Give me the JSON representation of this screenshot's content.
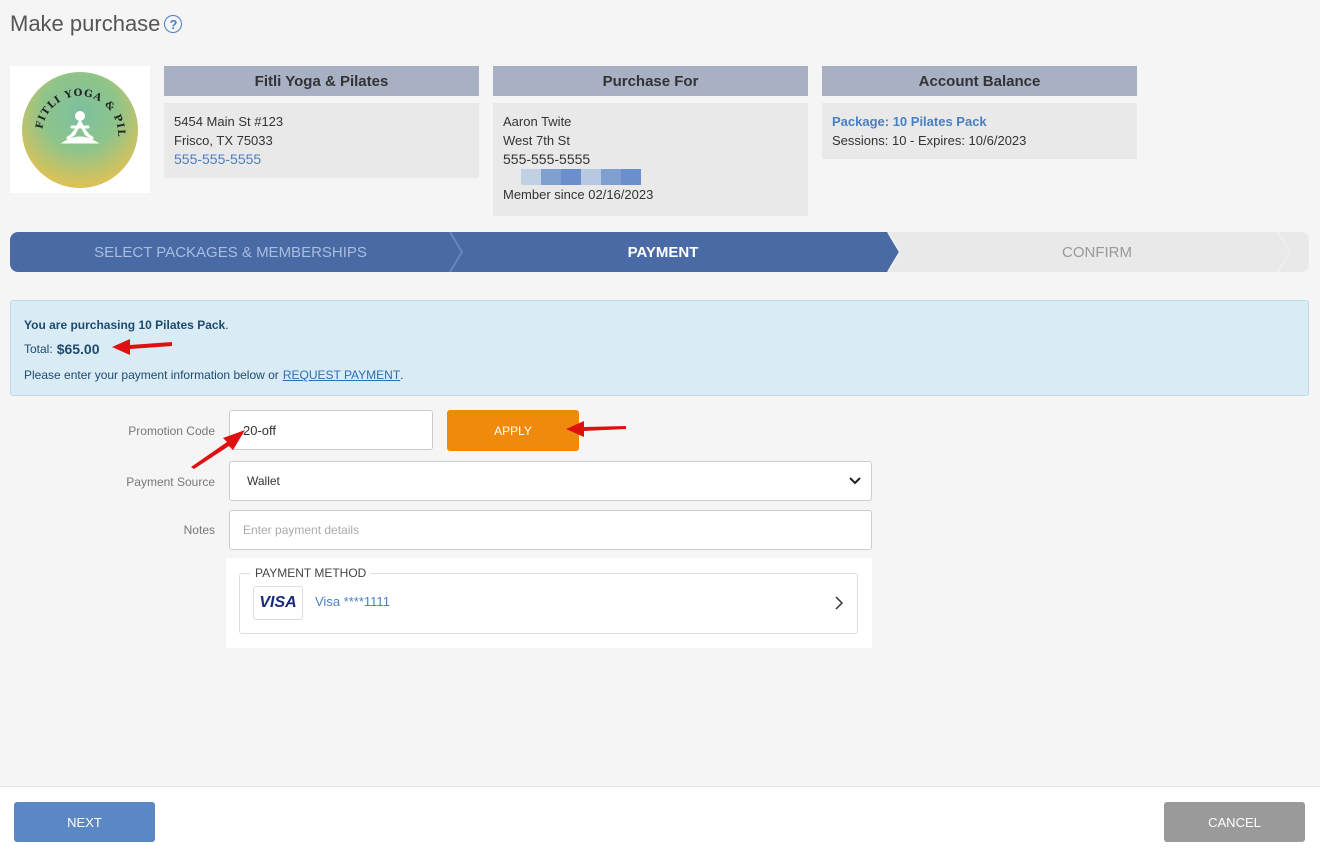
{
  "page": {
    "title": "Make purchase"
  },
  "studio": {
    "header": "Fitli Yoga & Pilates",
    "address1": "5454 Main St #123",
    "address2": "Frisco, TX 75033",
    "phone": "555-555-5555",
    "logo_text": "FITLI YOGA & PILATES"
  },
  "purchase_for": {
    "header": "Purchase For",
    "name": "Aaron Twite",
    "street": "West 7th St",
    "phone": "555-555-5555",
    "member_since": "Member since 02/16/2023"
  },
  "account_balance": {
    "header": "Account Balance",
    "package": "Package: 10 Pilates Pack",
    "details": "Sessions: 10 - Expires: 10/6/2023"
  },
  "steps": [
    {
      "label": "SELECT PACKAGES & MEMBERSHIPS",
      "state": "done"
    },
    {
      "label": "PAYMENT",
      "state": "active"
    },
    {
      "label": "CONFIRM",
      "state": "upcoming"
    }
  ],
  "alert": {
    "purchasing_prefix": "You are purchasing",
    "purchasing_item": "10 Pilates Pack",
    "purchasing_suffix": ".",
    "total_label": "Total:",
    "total_value": "$65.00",
    "enter_text": "Please enter your payment information below or",
    "request_link": "REQUEST PAYMENT",
    "enter_suffix": "."
  },
  "form": {
    "promo_label": "Promotion Code",
    "promo_value": "20-off",
    "apply_label": "APPLY",
    "source_label": "Payment Source",
    "source_value": "Wallet",
    "notes_label": "Notes",
    "notes_placeholder": "Enter payment details"
  },
  "payment_method": {
    "legend": "PAYMENT METHOD",
    "brand": "VISA",
    "card_text": "Visa ****1111"
  },
  "footer": {
    "next_label": "NEXT",
    "cancel_label": "CANCEL"
  },
  "colors": {
    "step_active": "#4a6aa5",
    "apply": "#ef8a0c",
    "next": "#5b87c5",
    "cancel": "#9a9a9a",
    "annotation_arrow": "#e01010"
  }
}
